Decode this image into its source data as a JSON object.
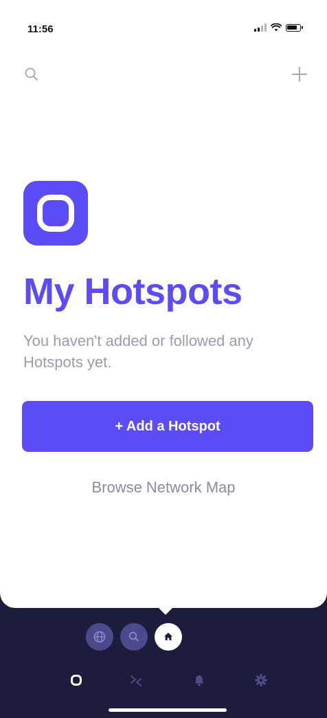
{
  "status_bar": {
    "time": "11:56"
  },
  "header": {
    "search_icon": "search-icon",
    "add_icon": "plus-icon"
  },
  "main": {
    "logo_icon": "rounded-square-icon",
    "title": "My Hotspots",
    "empty_message": "You haven't added or followed any Hotspots yet.",
    "add_button_label": "+ Add a Hotspot",
    "browse_link_label": "Browse Network Map"
  },
  "floating_nav": {
    "items": [
      "globe-icon",
      "search-icon",
      "home-icon"
    ],
    "active": "home-icon"
  },
  "tab_bar": {
    "items": [
      "hotspots-icon",
      "transfer-icon",
      "bell-icon",
      "gear-icon"
    ],
    "active": "hotspots-icon"
  },
  "colors": {
    "accent": "#5b4cf5",
    "dark_background": "#1c1c3c",
    "muted_text": "#9a9ab4",
    "nav_pill": "#4a4a8c"
  }
}
